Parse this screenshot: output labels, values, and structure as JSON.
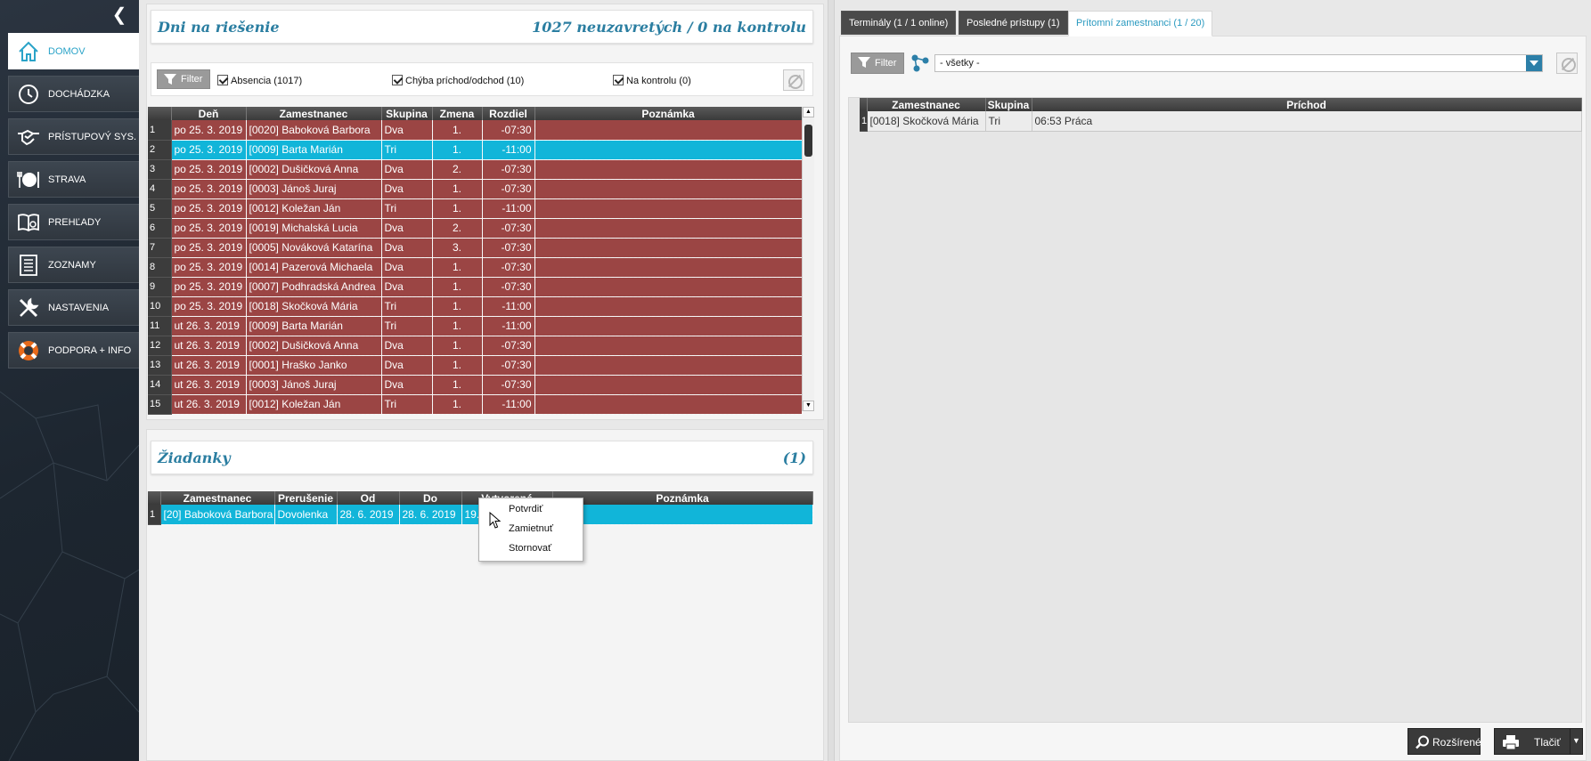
{
  "sidebar": {
    "collapse_glyph": "❮",
    "items": [
      {
        "label": "DOMOV",
        "icon": "home-icon",
        "active": true
      },
      {
        "label": "DOCHÁDZKA",
        "icon": "clock-icon"
      },
      {
        "label": "PRÍSTUPOVÝ SYS.",
        "icon": "handshake-icon"
      },
      {
        "label": "STRAVA",
        "icon": "plate-icon"
      },
      {
        "label": "PREHĽADY",
        "icon": "book-icon"
      },
      {
        "label": "ZOZNAMY",
        "icon": "list-icon"
      },
      {
        "label": "NASTAVENIA",
        "icon": "tools-icon"
      },
      {
        "label": "PODPORA + INFO",
        "icon": "lifebuoy-icon"
      }
    ]
  },
  "issues": {
    "title": "Dni na riešenie",
    "summary": "1027 neuzavretých / 0 na kontrolu",
    "filter_label": "Filter",
    "checkboxes": [
      {
        "label": "Absencia (1017)",
        "checked": true
      },
      {
        "label": "Chýba príchod/odchod (10)",
        "checked": true
      },
      {
        "label": "Na kontrolu (0)",
        "checked": true
      }
    ],
    "columns": [
      "Deň",
      "Zamestnanec",
      "Skupina",
      "Zmena",
      "Rozdiel",
      "Poznámka"
    ],
    "rows": [
      {
        "n": "1",
        "day": "po 25. 3. 2019",
        "emp": "[0020] Baboková Barbora",
        "group": "Dva",
        "shift": "1.",
        "diff": "-07:30",
        "note": ""
      },
      {
        "n": "2",
        "day": "po 25. 3. 2019",
        "emp": "[0009] Barta Marián",
        "group": "Tri",
        "shift": "1.",
        "diff": "-11:00",
        "note": "",
        "selected": true
      },
      {
        "n": "3",
        "day": "po 25. 3. 2019",
        "emp": "[0002] Dušičková Anna",
        "group": "Dva",
        "shift": "2.",
        "diff": "-07:30",
        "note": ""
      },
      {
        "n": "4",
        "day": "po 25. 3. 2019",
        "emp": "[0003] Jánoš Juraj",
        "group": "Dva",
        "shift": "1.",
        "diff": "-07:30",
        "note": ""
      },
      {
        "n": "5",
        "day": "po 25. 3. 2019",
        "emp": "[0012] Koležan Ján",
        "group": "Tri",
        "shift": "1.",
        "diff": "-11:00",
        "note": ""
      },
      {
        "n": "6",
        "day": "po 25. 3. 2019",
        "emp": "[0019] Michalská Lucia",
        "group": "Dva",
        "shift": "2.",
        "diff": "-07:30",
        "note": ""
      },
      {
        "n": "7",
        "day": "po 25. 3. 2019",
        "emp": "[0005] Nováková Katarína",
        "group": "Dva",
        "shift": "3.",
        "diff": "-07:30",
        "note": ""
      },
      {
        "n": "8",
        "day": "po 25. 3. 2019",
        "emp": "[0014] Pazerová Michaela",
        "group": "Dva",
        "shift": "1.",
        "diff": "-07:30",
        "note": ""
      },
      {
        "n": "9",
        "day": "po 25. 3. 2019",
        "emp": "[0007] Podhradská Andrea",
        "group": "Dva",
        "shift": "1.",
        "diff": "-07:30",
        "note": ""
      },
      {
        "n": "10",
        "day": "po 25. 3. 2019",
        "emp": "[0018] Skočková Mária",
        "group": "Tri",
        "shift": "1.",
        "diff": "-11:00",
        "note": ""
      },
      {
        "n": "11",
        "day": "ut 26. 3. 2019",
        "emp": "[0009] Barta Marián",
        "group": "Tri",
        "shift": "1.",
        "diff": "-11:00",
        "note": ""
      },
      {
        "n": "12",
        "day": "ut 26. 3. 2019",
        "emp": "[0002] Dušičková Anna",
        "group": "Dva",
        "shift": "1.",
        "diff": "-07:30",
        "note": ""
      },
      {
        "n": "13",
        "day": "ut 26. 3. 2019",
        "emp": "[0001] Hraško Janko",
        "group": "Dva",
        "shift": "1.",
        "diff": "-07:30",
        "note": ""
      },
      {
        "n": "14",
        "day": "ut 26. 3. 2019",
        "emp": "[0003] Jánoš Juraj",
        "group": "Dva",
        "shift": "1.",
        "diff": "-07:30",
        "note": ""
      },
      {
        "n": "15",
        "day": "ut 26. 3. 2019",
        "emp": "[0012] Koležan Ján",
        "group": "Tri",
        "shift": "1.",
        "diff": "-11:00",
        "note": ""
      }
    ]
  },
  "requests": {
    "title": "Žiadanky",
    "count": "(1)",
    "columns": [
      "Zamestnanec",
      "Prerušenie",
      "Od",
      "Do",
      "Vytvorené",
      "Poznámka"
    ],
    "rows": [
      {
        "n": "1",
        "emp": "[20] Baboková Barbora",
        "reason": "Dovolenka",
        "from": "28. 6. 2019",
        "to": "28. 6. 2019",
        "created": "19.",
        "note": ""
      }
    ]
  },
  "context_menu": {
    "items": [
      "Potvrdiť",
      "Zamietnuť",
      "Stornovať"
    ]
  },
  "right": {
    "tabs": [
      {
        "label": "Terminály (1 / 1 online)"
      },
      {
        "label": "Posledné prístupy (1)"
      },
      {
        "label": "Prítomní zamestnanci (1 / 20)",
        "active": true
      }
    ],
    "filter_label": "Filter",
    "select_value": "- všetky -",
    "columns": [
      "Zamestnanec",
      "Skupina",
      "Príchod"
    ],
    "rows": [
      {
        "n": "1",
        "emp": "[0018] Skočková Mária",
        "group": "Tri",
        "arrival": "06:53 Práca"
      }
    ],
    "buttons": {
      "advanced": "Rozšírené",
      "print": "Tlačiť"
    }
  },
  "colors": {
    "accent": "#2aa3c8",
    "row_red": "#9b4544",
    "row_selected": "#11b5d9",
    "header_dark": "#3a3a3a"
  }
}
